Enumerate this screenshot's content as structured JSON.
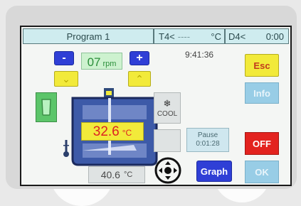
{
  "header": {
    "program_label": "Program 1",
    "t4_label": "T4<",
    "t4_value": "----",
    "t4_unit": "°C",
    "d4_label": "D4<",
    "d4_value": "0:00"
  },
  "speed": {
    "value": "07",
    "unit": "rpm",
    "decrease_label": "-",
    "increase_label": "+"
  },
  "clock": "9:41:36",
  "vessel": {
    "temperature_value": "32.6",
    "temperature_unit": "°C"
  },
  "cooling": {
    "label": "COOL"
  },
  "sensor_reading": {
    "value": "40.6",
    "unit": "°C"
  },
  "pause": {
    "label": "Pause",
    "time": "0:01:28"
  },
  "buttons": {
    "esc_label": "Esc",
    "info_label": "Info",
    "off_label": "OFF",
    "graph_label": "Graph",
    "ok_label": "OK"
  },
  "colors": {
    "blue_button": "#2f3fd6",
    "yellow_button": "#f2ea3a",
    "red_button": "#e3231f",
    "light_blue_button": "#98cde6",
    "green": "#5cc56a",
    "header_bg": "#cfecef"
  }
}
